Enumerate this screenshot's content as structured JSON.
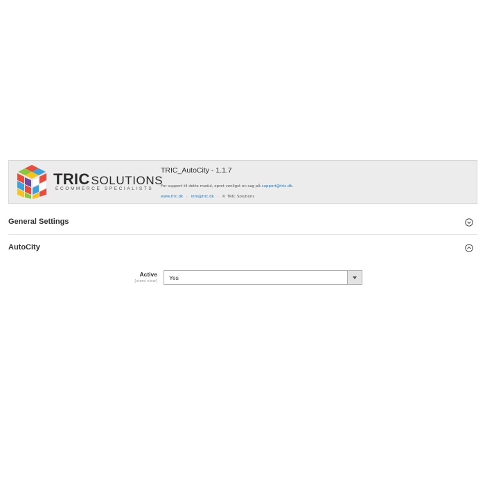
{
  "banner": {
    "brand_strong": "TRIC",
    "brand_light": "SOLUTIONS",
    "tagline": "ECOMMERCE SPECIALISTS",
    "extension_title": "TRIC_AutoCity - 1.1.7",
    "support_text": "For support til dette modul, opret venligst en sag på",
    "support_email": "support@tric.dk",
    "support_end": ".",
    "link_website": "www.tric.dk",
    "link_email": "info@tric.dk",
    "separator": "-",
    "copyright": "© TRIC Solutions",
    "logo_icon": "rubiks-cube-logo",
    "link_color": "#1979c3"
  },
  "sections": {
    "general": {
      "title": "General Settings",
      "state": "collapsed",
      "icon": "chevron-down-circle-icon"
    },
    "autocity": {
      "title": "AutoCity",
      "state": "expanded",
      "icon": "chevron-up-circle-icon"
    }
  },
  "fields": {
    "active": {
      "label": "Active",
      "scope": "[store view]",
      "value": "Yes",
      "icon": "caret-down-icon"
    }
  }
}
